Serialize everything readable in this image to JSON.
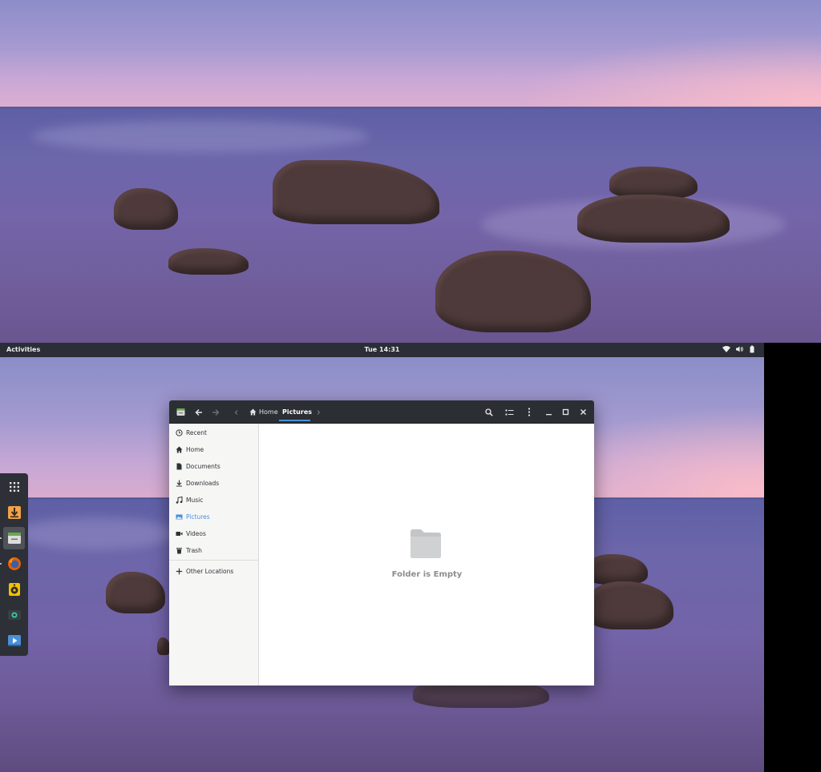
{
  "topbar": {
    "activities": "Activities",
    "clock": "Tue 14:31",
    "tray": [
      "wifi-icon",
      "volume-icon",
      "battery-icon"
    ]
  },
  "dock": {
    "items": [
      {
        "icon": "show-apps-icon",
        "active": false
      },
      {
        "icon": "downloader-app-icon",
        "active": false
      },
      {
        "icon": "files-app-icon",
        "active": true
      },
      {
        "icon": "firefox-icon",
        "active": false
      },
      {
        "icon": "rhythmbox-icon",
        "active": false
      },
      {
        "icon": "camera-app-icon",
        "active": false
      },
      {
        "icon": "video-player-icon",
        "active": false
      }
    ]
  },
  "window": {
    "path": [
      {
        "label": "Home",
        "icon": "home-icon"
      },
      {
        "label": "Pictures",
        "current": true
      }
    ],
    "sidebar": [
      {
        "label": "Recent",
        "icon": "clock-icon"
      },
      {
        "label": "Home",
        "icon": "home-icon"
      },
      {
        "label": "Documents",
        "icon": "document-icon"
      },
      {
        "label": "Downloads",
        "icon": "download-icon"
      },
      {
        "label": "Music",
        "icon": "music-icon"
      },
      {
        "label": "Pictures",
        "icon": "image-icon",
        "selected": true
      },
      {
        "label": "Videos",
        "icon": "video-icon"
      },
      {
        "label": "Trash",
        "icon": "trash-icon"
      },
      {
        "label": "Other Locations",
        "icon": "plus-icon"
      }
    ],
    "empty_message": "Folder is Empty"
  },
  "colors": {
    "accent": "#4a90d9",
    "headerbar": "#2b2f33",
    "topbar": "#2b2e37"
  }
}
